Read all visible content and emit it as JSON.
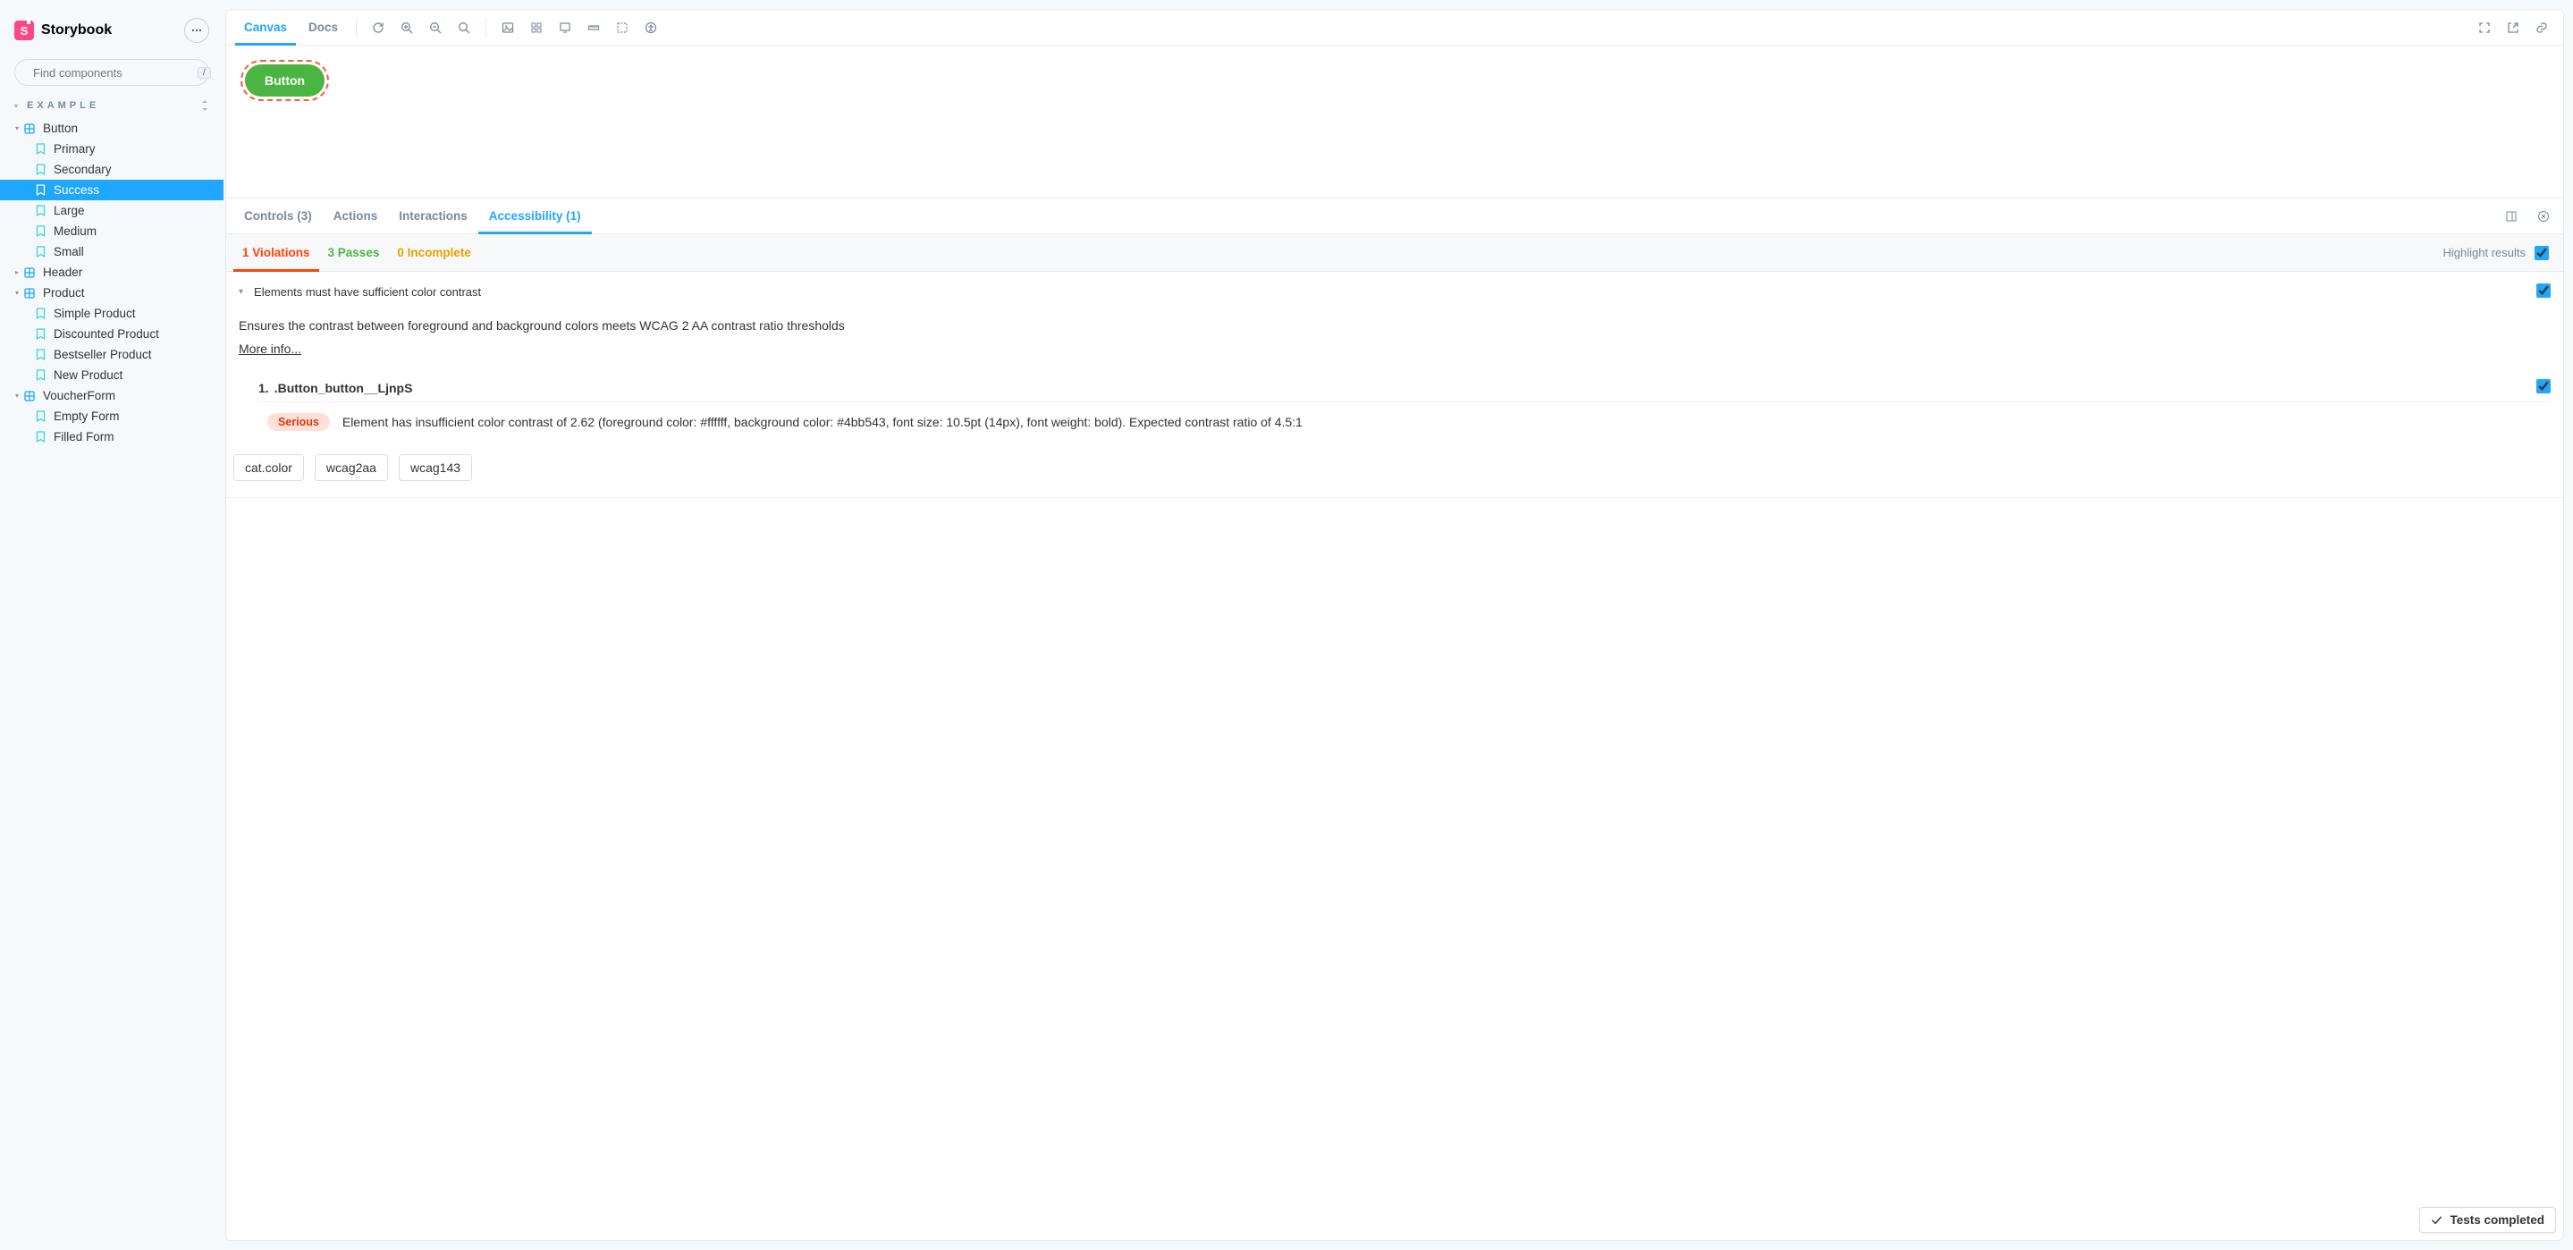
{
  "brand": {
    "name": "Storybook",
    "logoLetter": "S"
  },
  "search": {
    "placeholder": "Find components",
    "shortcut": "/"
  },
  "section": {
    "title": "EXAMPLE"
  },
  "tree": {
    "components": [
      {
        "name": "Button",
        "expanded": true,
        "stories": [
          {
            "name": "Primary",
            "active": false
          },
          {
            "name": "Secondary",
            "active": false
          },
          {
            "name": "Success",
            "active": true
          },
          {
            "name": "Large",
            "active": false
          },
          {
            "name": "Medium",
            "active": false
          },
          {
            "name": "Small",
            "active": false
          }
        ]
      },
      {
        "name": "Header",
        "expanded": false,
        "stories": []
      },
      {
        "name": "Product",
        "expanded": true,
        "stories": [
          {
            "name": "Simple Product"
          },
          {
            "name": "Discounted Product"
          },
          {
            "name": "Bestseller Product"
          },
          {
            "name": "New Product"
          }
        ]
      },
      {
        "name": "VoucherForm",
        "expanded": true,
        "stories": [
          {
            "name": "Empty Form"
          },
          {
            "name": "Filled Form"
          }
        ]
      }
    ]
  },
  "toolbar": {
    "tabs": {
      "canvas": "Canvas",
      "docs": "Docs"
    }
  },
  "story": {
    "buttonLabel": "Button"
  },
  "addons": {
    "tabs": {
      "controls": "Controls (3)",
      "actions": "Actions",
      "interactions": "Interactions",
      "accessibility": "Accessibility (1)"
    }
  },
  "a11y": {
    "subtabs": {
      "violations": "1 Violations",
      "passes": "3 Passes",
      "incomplete": "0 Incomplete"
    },
    "highlightLabel": "Highlight results",
    "rule": {
      "title": "Elements must have sufficient color contrast",
      "description": "Ensures the contrast between foreground and background colors meets WCAG 2 AA contrast ratio thresholds",
      "moreInfo": "More info...",
      "node": {
        "index": "1.",
        "selector": ".Button_button__LjnpS",
        "impact": "Serious",
        "message": "Element has insufficient color contrast of 2.62 (foreground color: #ffffff, background color: #4bb543, font size: 10.5pt (14px), font weight: bold). Expected contrast ratio of 4.5:1"
      },
      "tags": [
        "cat.color",
        "wcag2aa",
        "wcag143"
      ]
    }
  },
  "status": {
    "label": "Tests completed"
  }
}
